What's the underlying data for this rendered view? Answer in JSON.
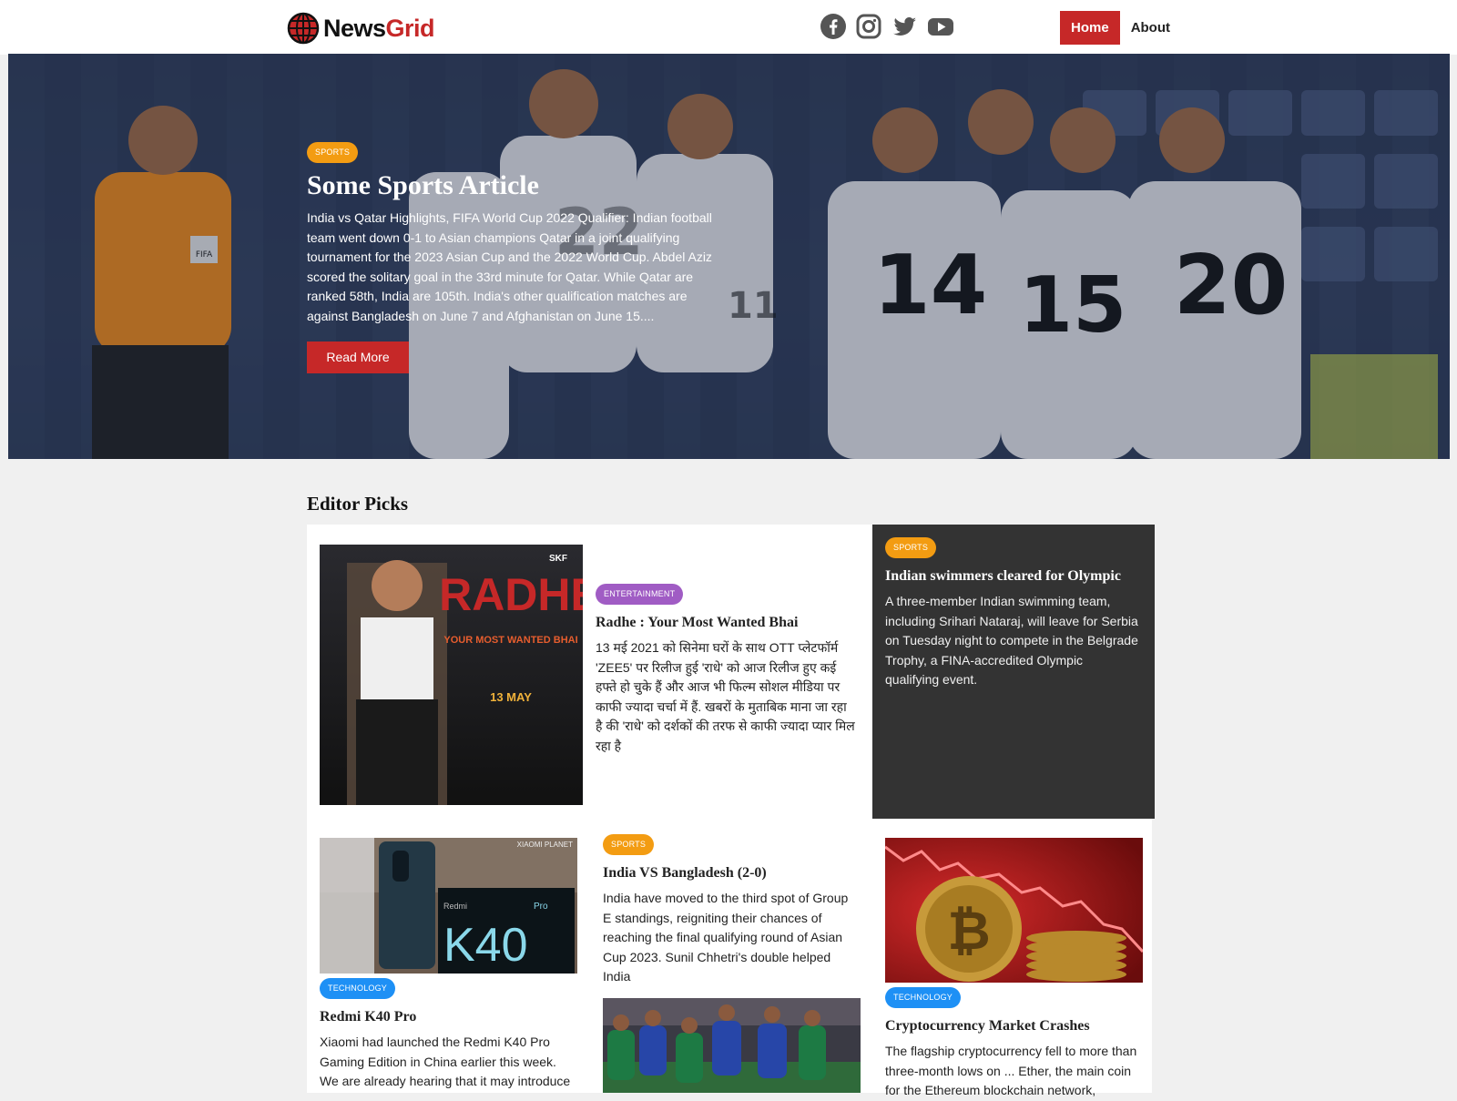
{
  "header": {
    "brand_part1": "News",
    "brand_part2": "Grid",
    "nav": {
      "home": "Home",
      "about": "About"
    },
    "social_icons": [
      "facebook-icon",
      "instagram-icon",
      "twitter-icon",
      "youtube-icon"
    ]
  },
  "hero": {
    "category": "SPORTS",
    "title": "Some Sports Article",
    "text": "India vs Qatar Highlights, FIFA World Cup 2022 Qualifier: Indian football team went down 0-1 to Asian champions Qatar in a joint qualifying tournament for the 2023 Asian Cup and the 2022 World Cup. Abdel Aziz scored the solitary goal in the 33rd minute for Qatar. While Qatar are ranked 58th, India are 105th. India's other qualification matches are against Bangladesh on June 7 and Afghanistan on June 15....",
    "button": "Read More",
    "jersey_numbers": [
      "14",
      "15",
      "20",
      "22",
      "11"
    ],
    "referee_badge": "FIFA"
  },
  "editor_picks": {
    "title": "Editor Picks",
    "cards": [
      {
        "category": "ENTERTAINMENT",
        "title": "Radhe : Your Most Wanted Bhai",
        "text": "13 मई 2021 को सिनेमा घरों के साथ OTT प्लेटफॉर्म 'ZEE5' पर रिलीज हुई 'राधे' को आज रिलीज हुए कई हफ्ते हो चुके हैं और आज भी फिल्म सोशल मीडिया पर काफी ज्यादा चर्चा में हैं. खबरों के मुताबिक माना जा रहा है की 'राधे' को दर्शकों की तरफ से काफी ज्यादा प्यार मिल रहा है",
        "poster": {
          "title": "RADHE",
          "subtitle": "YOUR MOST WANTED BHAI",
          "date": "13 MAY",
          "corner": "SKF"
        }
      },
      {
        "category": "SPORTS",
        "title": "Indian swimmers cleared for Olympic",
        "text": "A three-member Indian swimming team, including Srihari Nataraj, will leave for Serbia on Tuesday night to compete in the Belgrade Trophy, a FINA-accredited Olympic qualifying event."
      },
      {
        "category": "TECHNOLOGY",
        "title": "Redmi K40 Pro",
        "text": "Xiaomi had launched the Redmi K40 Pro Gaming Edition in China earlier this week. We are already hearing that it may introduce",
        "box": {
          "brand": "Redmi",
          "model": "K40",
          "tier": "Pro",
          "watermark": "XIAOMI PLANET"
        }
      },
      {
        "category": "SPORTS",
        "title": "India VS Bangladesh (2-0)",
        "text": "India have moved to the third spot of Group E standings, reigniting their chances of reaching the final qualifying round of Asian Cup 2023. Sunil Chhetri's double helped India"
      },
      {
        "category": "TECHNOLOGY",
        "title": "Cryptocurrency Market Crashes",
        "text": "The flagship cryptocurrency fell to more than three-month lows on ... Ether, the main coin for the Ethereum blockchain network,"
      }
    ]
  },
  "colors": {
    "accent": "#c62828",
    "sports_badge": "#f39c12",
    "entertainment_badge": "#a05cc4",
    "technology_badge": "#1e90f5",
    "dark_card": "#333333"
  }
}
